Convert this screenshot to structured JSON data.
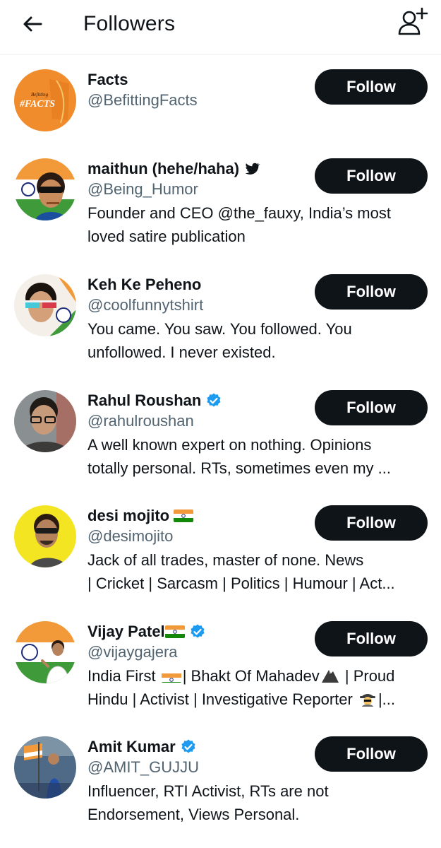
{
  "header": {
    "title": "Followers",
    "back_icon": "arrow-left-icon",
    "add_user_icon": "person-plus-icon"
  },
  "colors": {
    "text": "#0f1419",
    "secondary": "#536471",
    "button": "#0f1419",
    "verified": "#1d9bf0"
  },
  "users": [
    {
      "name": "Facts",
      "handle": "@BefittingFacts",
      "bio": [],
      "follow_label": "Follow",
      "avatar_text": "#FACTS",
      "avatar_small": "Befitting"
    },
    {
      "name": "maithun (hehe/haha)",
      "handle": "@Being_Humor",
      "bio": [
        "Founder and CEO @the_fauxy, India’s most",
        "loved satire publication"
      ],
      "follow_label": "Follow",
      "badge": "bird-icon"
    },
    {
      "name": "Keh Ke Peheno",
      "handle": "@coolfunnytshirt",
      "bio": [
        "You came. You saw. You followed. You",
        "unfollowed. I never existed."
      ],
      "follow_label": "Follow"
    },
    {
      "name": "Rahul Roushan",
      "handle": "@rahulroushan",
      "bio": [
        "A well known expert on nothing. Opinions",
        "totally personal. RTs, sometimes even my ..."
      ],
      "follow_label": "Follow",
      "badge": "verified-icon"
    },
    {
      "name": "desi mojito",
      "handle": "@desimojito",
      "bio": [
        "Jack of all trades, master of none. News",
        "| Cricket | Sarcasm | Politics | Humour | Act..."
      ],
      "follow_label": "Follow",
      "badge": "india-flag-icon"
    },
    {
      "name": "Vijay Patel",
      "handle": "@vijaygajera",
      "bio_parts": {
        "line1_a": "India First ",
        "line1_b": "| Bhakt Of Mahadev",
        "line1_c": " | Proud",
        "line2_a": "Hindu | Activist | Investigative Reporter ",
        "line2_b": "|..."
      },
      "follow_label": "Follow",
      "badge": "verified-icon"
    },
    {
      "name": "Amit Kumar",
      "handle": "@AMIT_GUJJU",
      "bio": [
        "Influencer, RTI Activist, RTs are not",
        "Endorsement, Views Personal."
      ],
      "follow_label": "Follow",
      "badge": "verified-icon"
    }
  ]
}
